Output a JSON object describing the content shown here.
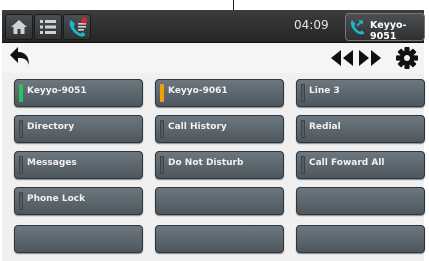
{
  "header": {
    "time": "04:09",
    "line_chip_label": "Keyyo-9051",
    "icons": [
      "home-icon",
      "menu-list-icon",
      "call-log-icon",
      "phone-icon"
    ]
  },
  "toolbar": {
    "icons": [
      "back-arrow-icon",
      "previous-page-icon",
      "next-page-icon",
      "settings-icon"
    ]
  },
  "keys": [
    {
      "label": "Keyyo-9051",
      "indicator": "#22c55e"
    },
    {
      "label": "Keyyo-9061",
      "indicator": "#f59e0b"
    },
    {
      "label": "Line 3",
      "indicator": null
    },
    {
      "label": "Directory",
      "indicator": null
    },
    {
      "label": "Call History",
      "indicator": null
    },
    {
      "label": "Redial",
      "indicator": null
    },
    {
      "label": "Messages",
      "indicator": null
    },
    {
      "label": "Do Not Disturb",
      "indicator": null
    },
    {
      "label": "Call Foward All",
      "indicator": null
    },
    {
      "label": "Phone Lock",
      "indicator": null
    },
    {
      "label": "",
      "indicator": null
    },
    {
      "label": "",
      "indicator": null
    },
    {
      "label": "",
      "indicator": null
    },
    {
      "label": "",
      "indicator": null
    },
    {
      "label": "",
      "indicator": null
    }
  ],
  "colors": {
    "accent_teal": "#1fb5c9",
    "notification_red": "#e02424"
  }
}
